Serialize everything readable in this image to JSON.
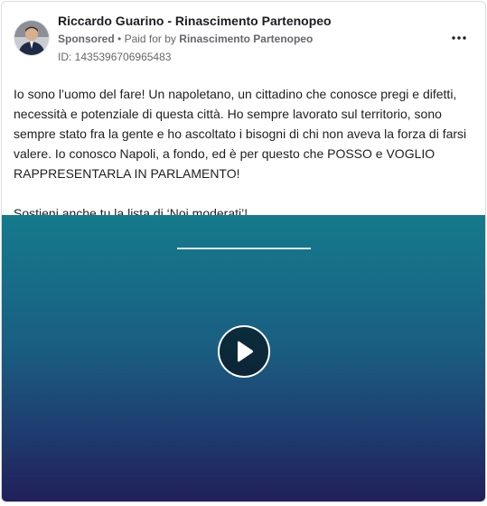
{
  "ad": {
    "page_name": "Riccardo Guarino - Rinascimento Partenopeo",
    "sponsored_label": "Sponsored",
    "separator": "•",
    "paid_for_prefix": "Paid for by",
    "paid_for_by": "Rinascimento Partenopeo",
    "ad_id_text": "ID: 1435396706965483",
    "body": {
      "paragraph_1": "Io sono l’uomo del fare! Un napoletano, un cittadino che conosce pregi e difetti,\nnecessità e potenziale di questa città. Ho sempre lavorato sul territorio, sono\nsempre stato fra la gente e ho ascoltato i bisogni di chi non aveva la forza di farsi\nvalere. Io conosco Napoli, a fondo, ed è per questo che POSSO e VOGLIO\nRAPPRESENTARLA IN PARLAMENTO!",
      "paragraph_2": "Sostieni anche tu la lista di ‘Noi moderati’!..."
    }
  },
  "icons": {
    "more": "more-horizontal-icon",
    "play": "play-icon"
  },
  "colors": {
    "video_top": "#157a8c",
    "video_bottom": "#221f5a",
    "name_text": "#1c1e21",
    "meta_text": "#65676b"
  }
}
